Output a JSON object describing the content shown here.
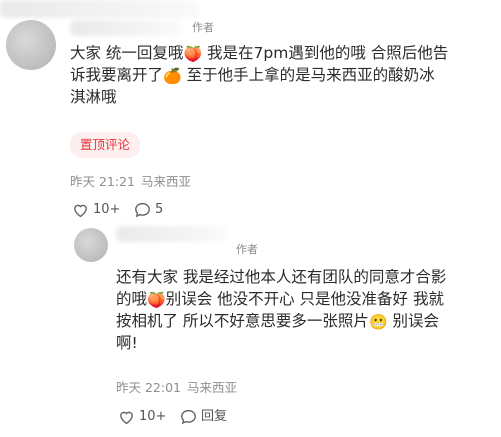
{
  "comment1": {
    "author_tag": "作者",
    "text_line1": "大家 统一回复哦",
    "text_line1b": " 我是在7pm遇到他的哦 合照后他告",
    "text_line2a": "诉我要离开了",
    "text_line2b": " 至于他手上拿的是马来西亚的酸奶冰",
    "text_line3": "淇淋哦",
    "pin_label": "置顶评论",
    "time": "昨天 21:21",
    "location": "马来西亚",
    "likes": "10+",
    "replies": "5"
  },
  "comment2": {
    "author_tag": "作者",
    "text_line1": "还有大家 我是经过他本人还有团队的同意才合影",
    "text_line2a": "的哦",
    "text_line2b": "别误会 他没不开心 只是他没准备好 我就",
    "text_line3a": "按相机了 所以不好意思要多一张照片",
    "text_line3b": " 别误会",
    "text_line4": "啊!",
    "time": "昨天 22:01",
    "location": "马来西亚",
    "likes": "10+",
    "reply_label": "回复"
  },
  "icons": {
    "heart": "heart-outline-icon",
    "comment": "comment-bubble-icon"
  },
  "colors": {
    "pin_bg": "#fdeef0",
    "pin_text": "#e4383b",
    "meta_text": "#8f8f8f"
  }
}
